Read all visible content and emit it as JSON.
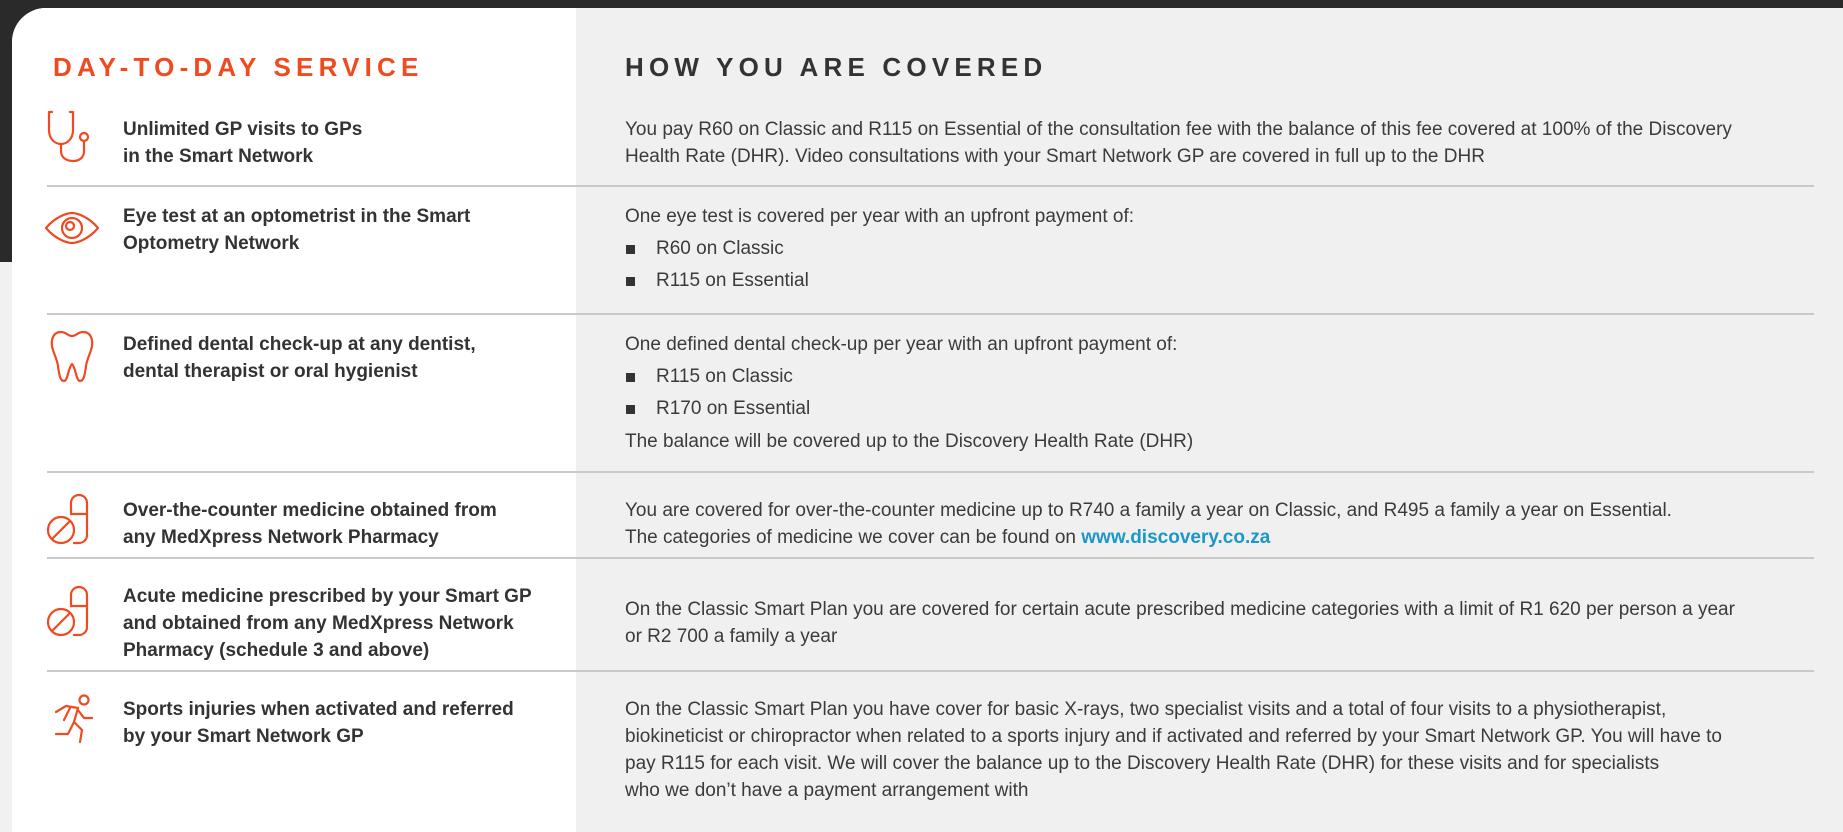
{
  "headers": {
    "left": "DAY-TO-DAY SERVICE",
    "right": "HOW YOU ARE COVERED"
  },
  "colors": {
    "accent": "#f04a21",
    "link": "#1a98c8",
    "text": "#333333"
  },
  "rows": [
    {
      "icon": "stethoscope-icon",
      "service": [
        "Unlimited GP visits to GPs",
        "in the Smart Network"
      ],
      "coverage_lines": [
        "You pay R60 on Classic and R115 on Essential of the consultation fee with the balance of this fee covered at 100% of the Discovery",
        "Health Rate (DHR). Video consultations with your Smart Network GP are covered in full up to the DHR"
      ]
    },
    {
      "icon": "eye-icon",
      "service": [
        "Eye test at an optometrist in the Smart",
        "Optometry Network"
      ],
      "coverage_intro": "One eye test is covered per year with an upfront payment of:",
      "bullets": [
        "R60 on Classic",
        "R115 on Essential"
      ]
    },
    {
      "icon": "tooth-icon",
      "service": [
        "Defined dental check-up at any dentist,",
        "dental therapist or oral hygienist"
      ],
      "coverage_intro": "One defined dental check-up per year with an upfront payment of:",
      "bullets": [
        "R115 on Classic",
        "R170 on Essential"
      ],
      "coverage_outro": "The balance will be covered up to the Discovery Health Rate (DHR)"
    },
    {
      "icon": "medicine-icon",
      "service": [
        "Over-the-counter medicine obtained from",
        "any MedXpress Network Pharmacy"
      ],
      "coverage_line1": "You are covered for over-the-counter medicine up to R740 a family a year on Classic, and R495 a family a year on Essential.",
      "coverage_line2_prefix": "The categories of medicine we cover can be found on ",
      "link": "www.discovery.co.za"
    },
    {
      "icon": "prescription-medicine-icon",
      "service": [
        "Acute medicine prescribed by your Smart GP",
        "and obtained from any MedXpress Network",
        "Pharmacy (schedule 3 and above)"
      ],
      "coverage_lines": [
        "On the Classic Smart Plan you are covered for certain acute prescribed medicine categories with a limit of R1 620 per person a year",
        "or R2 700 a family a year"
      ]
    },
    {
      "icon": "runner-icon",
      "service": [
        "Sports injuries when activated and referred",
        "by your Smart Network GP"
      ],
      "coverage_lines": [
        "On the Classic Smart Plan you have cover for basic X-rays, two specialist visits and a total of four visits to a physiotherapist,",
        "biokineticist or chiropractor when related to a sports injury and if activated and referred by your Smart Network GP. You will have to",
        "pay R115 for each visit. We will cover the balance up to the Discovery Health Rate (DHR) for these visits and for specialists",
        "who we don’t have a payment arrangement with"
      ]
    }
  ]
}
